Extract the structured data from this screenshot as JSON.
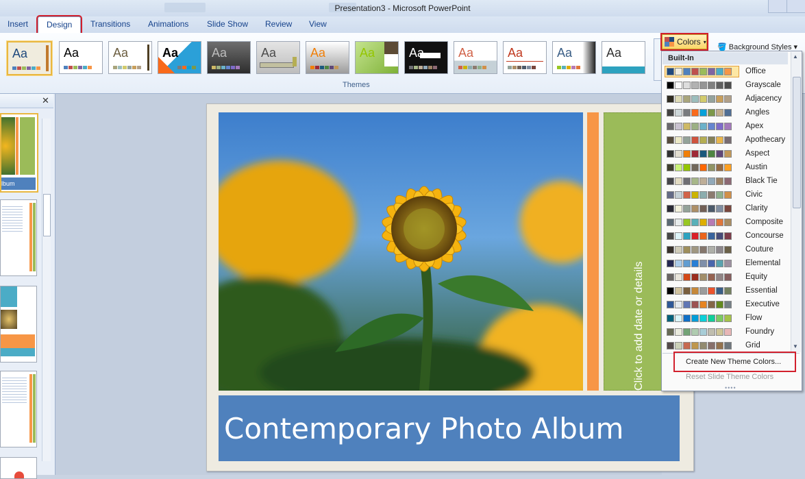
{
  "window": {
    "title": "Presentation3 - Microsoft PowerPoint"
  },
  "tabs": [
    {
      "label": "Insert"
    },
    {
      "label": "Design",
      "active": true
    },
    {
      "label": "Transitions"
    },
    {
      "label": "Animations"
    },
    {
      "label": "Slide Show"
    },
    {
      "label": "Review"
    },
    {
      "label": "View"
    }
  ],
  "ribbon": {
    "group_label": "Themes",
    "theme_sample": "Aa",
    "colors_button": "Colors",
    "background_styles": "Background Styles"
  },
  "slide": {
    "title": "Contemporary Photo Album",
    "placeholder_vertical": "Click to add date or details",
    "thumb_album_label": "lbum"
  },
  "colors_menu": {
    "header": "Built-In",
    "schemes": [
      {
        "name": "Office",
        "colors": [
          "#1f497d",
          "#eeece1",
          "#4f81bd",
          "#c0504d",
          "#9bbb59",
          "#8064a2",
          "#4bacc6",
          "#f79646"
        ]
      },
      {
        "name": "Grayscale",
        "colors": [
          "#000000",
          "#f8f8f8",
          "#dddddd",
          "#b2b2b2",
          "#969696",
          "#808080",
          "#5f5f5f",
          "#4d4d4d"
        ]
      },
      {
        "name": "Adjacency",
        "colors": [
          "#2f2b20",
          "#dfdcb7",
          "#a9a57c",
          "#9cbebd",
          "#d2cb6c",
          "#95a39d",
          "#c89f5d",
          "#b1a089"
        ]
      },
      {
        "name": "Angles",
        "colors": [
          "#434342",
          "#cdd7d9",
          "#797b7e",
          "#f96a1b",
          "#08a1d9",
          "#7c984a",
          "#c2ad8d",
          "#506e94"
        ]
      },
      {
        "name": "Apex",
        "colors": [
          "#69676d",
          "#c9c2d1",
          "#ceb966",
          "#9cb084",
          "#6bb1c9",
          "#6585cf",
          "#7e6bc9",
          "#a379bb"
        ]
      },
      {
        "name": "Apothecary",
        "colors": [
          "#564b3c",
          "#ece9c6",
          "#93a299",
          "#cf543f",
          "#b5ae53",
          "#848058",
          "#e8b54d",
          "#786c71"
        ]
      },
      {
        "name": "Aspect",
        "colors": [
          "#323232",
          "#e3ded1",
          "#f07f09",
          "#9f2936",
          "#1b587c",
          "#4e8542",
          "#604878",
          "#c19859"
        ]
      },
      {
        "name": "Austin",
        "colors": [
          "#3e3d2d",
          "#caf278",
          "#94c600",
          "#71685a",
          "#ff6700",
          "#909465",
          "#956b43",
          "#fea022"
        ]
      },
      {
        "name": "Black Tie",
        "colors": [
          "#46464a",
          "#e3dcc3",
          "#6f6f74",
          "#a7b789",
          "#beae98",
          "#92a9b9",
          "#9c8265",
          "#8d6974"
        ]
      },
      {
        "name": "Civic",
        "colors": [
          "#646b86",
          "#c5d1d7",
          "#d16349",
          "#ccb400",
          "#8cadae",
          "#8c7b70",
          "#8fb08c",
          "#d19049"
        ]
      },
      {
        "name": "Clarity",
        "colors": [
          "#292934",
          "#f3f2dc",
          "#93a299",
          "#ad8f67",
          "#726056",
          "#4c5a6a",
          "#808da0",
          "#79463d"
        ]
      },
      {
        "name": "Composite",
        "colors": [
          "#5b6973",
          "#e7ecec",
          "#98c723",
          "#59b0b9",
          "#deae00",
          "#b77bb4",
          "#e0773c",
          "#a98d63"
        ]
      },
      {
        "name": "Concourse",
        "colors": [
          "#464646",
          "#def5fa",
          "#2da2bf",
          "#da1f28",
          "#eb641b",
          "#39639d",
          "#474b78",
          "#7d3c4a"
        ]
      },
      {
        "name": "Couture",
        "colors": [
          "#37302a",
          "#d0ccb9",
          "#9e8e5c",
          "#a09781",
          "#85776d",
          "#aeafa9",
          "#8d878b",
          "#6b6149"
        ]
      },
      {
        "name": "Elemental",
        "colors": [
          "#242852",
          "#acccea",
          "#629dd1",
          "#297fd5",
          "#7f8fa9",
          "#4a66ac",
          "#5aa2ae",
          "#9d90a0"
        ]
      },
      {
        "name": "Equity",
        "colors": [
          "#696464",
          "#e9e5dc",
          "#d34817",
          "#9b2d1f",
          "#a28e6a",
          "#956251",
          "#918485",
          "#855d5d"
        ]
      },
      {
        "name": "Essential",
        "colors": [
          "#000000",
          "#d1c39f",
          "#7a5f3e",
          "#c7893a",
          "#9c9c9c",
          "#ec542d",
          "#3a5e86",
          "#74805f"
        ]
      },
      {
        "name": "Executive",
        "colors": [
          "#2f5897",
          "#e4e9ef",
          "#6076b4",
          "#9c5252",
          "#e68422",
          "#846648",
          "#63891f",
          "#758085"
        ]
      },
      {
        "name": "Flow",
        "colors": [
          "#04617b",
          "#dbf5f9",
          "#0f6fc6",
          "#009dd9",
          "#0bd0d9",
          "#10cf9b",
          "#7cca62",
          "#a5c249"
        ]
      },
      {
        "name": "Foundry",
        "colors": [
          "#676a55",
          "#eaebde",
          "#72a376",
          "#b0ccb0",
          "#a8cdd7",
          "#c0beaf",
          "#cec597",
          "#e8b7b7"
        ]
      },
      {
        "name": "Grid",
        "colors": [
          "#534949",
          "#ccd1b9",
          "#c66951",
          "#bf974d",
          "#928b70",
          "#87706b",
          "#94734e",
          "#6f777d"
        ]
      }
    ],
    "create_new": "Create New Theme Colors...",
    "reset": "Reset Slide Theme Colors"
  }
}
